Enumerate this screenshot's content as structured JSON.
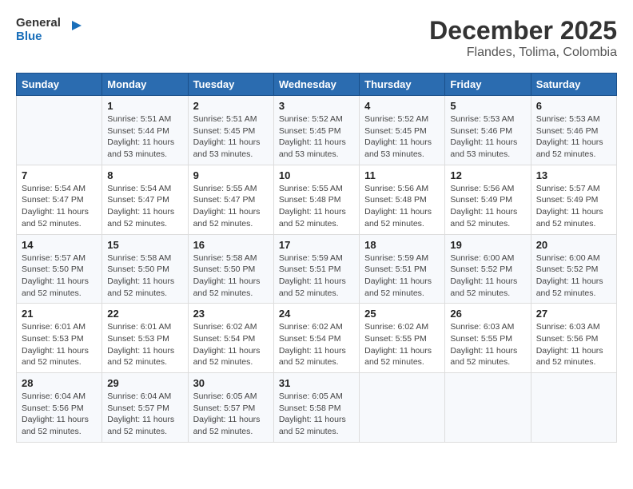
{
  "header": {
    "logo_line1": "General",
    "logo_line2": "Blue",
    "month": "December 2025",
    "location": "Flandes, Tolima, Colombia"
  },
  "days_of_week": [
    "Sunday",
    "Monday",
    "Tuesday",
    "Wednesday",
    "Thursday",
    "Friday",
    "Saturday"
  ],
  "weeks": [
    [
      {
        "day": "",
        "info": ""
      },
      {
        "day": "1",
        "info": "Sunrise: 5:51 AM\nSunset: 5:44 PM\nDaylight: 11 hours\nand 53 minutes."
      },
      {
        "day": "2",
        "info": "Sunrise: 5:51 AM\nSunset: 5:45 PM\nDaylight: 11 hours\nand 53 minutes."
      },
      {
        "day": "3",
        "info": "Sunrise: 5:52 AM\nSunset: 5:45 PM\nDaylight: 11 hours\nand 53 minutes."
      },
      {
        "day": "4",
        "info": "Sunrise: 5:52 AM\nSunset: 5:45 PM\nDaylight: 11 hours\nand 53 minutes."
      },
      {
        "day": "5",
        "info": "Sunrise: 5:53 AM\nSunset: 5:46 PM\nDaylight: 11 hours\nand 53 minutes."
      },
      {
        "day": "6",
        "info": "Sunrise: 5:53 AM\nSunset: 5:46 PM\nDaylight: 11 hours\nand 52 minutes."
      }
    ],
    [
      {
        "day": "7",
        "info": "Sunrise: 5:54 AM\nSunset: 5:47 PM\nDaylight: 11 hours\nand 52 minutes."
      },
      {
        "day": "8",
        "info": "Sunrise: 5:54 AM\nSunset: 5:47 PM\nDaylight: 11 hours\nand 52 minutes."
      },
      {
        "day": "9",
        "info": "Sunrise: 5:55 AM\nSunset: 5:47 PM\nDaylight: 11 hours\nand 52 minutes."
      },
      {
        "day": "10",
        "info": "Sunrise: 5:55 AM\nSunset: 5:48 PM\nDaylight: 11 hours\nand 52 minutes."
      },
      {
        "day": "11",
        "info": "Sunrise: 5:56 AM\nSunset: 5:48 PM\nDaylight: 11 hours\nand 52 minutes."
      },
      {
        "day": "12",
        "info": "Sunrise: 5:56 AM\nSunset: 5:49 PM\nDaylight: 11 hours\nand 52 minutes."
      },
      {
        "day": "13",
        "info": "Sunrise: 5:57 AM\nSunset: 5:49 PM\nDaylight: 11 hours\nand 52 minutes."
      }
    ],
    [
      {
        "day": "14",
        "info": "Sunrise: 5:57 AM\nSunset: 5:50 PM\nDaylight: 11 hours\nand 52 minutes."
      },
      {
        "day": "15",
        "info": "Sunrise: 5:58 AM\nSunset: 5:50 PM\nDaylight: 11 hours\nand 52 minutes."
      },
      {
        "day": "16",
        "info": "Sunrise: 5:58 AM\nSunset: 5:50 PM\nDaylight: 11 hours\nand 52 minutes."
      },
      {
        "day": "17",
        "info": "Sunrise: 5:59 AM\nSunset: 5:51 PM\nDaylight: 11 hours\nand 52 minutes."
      },
      {
        "day": "18",
        "info": "Sunrise: 5:59 AM\nSunset: 5:51 PM\nDaylight: 11 hours\nand 52 minutes."
      },
      {
        "day": "19",
        "info": "Sunrise: 6:00 AM\nSunset: 5:52 PM\nDaylight: 11 hours\nand 52 minutes."
      },
      {
        "day": "20",
        "info": "Sunrise: 6:00 AM\nSunset: 5:52 PM\nDaylight: 11 hours\nand 52 minutes."
      }
    ],
    [
      {
        "day": "21",
        "info": "Sunrise: 6:01 AM\nSunset: 5:53 PM\nDaylight: 11 hours\nand 52 minutes."
      },
      {
        "day": "22",
        "info": "Sunrise: 6:01 AM\nSunset: 5:53 PM\nDaylight: 11 hours\nand 52 minutes."
      },
      {
        "day": "23",
        "info": "Sunrise: 6:02 AM\nSunset: 5:54 PM\nDaylight: 11 hours\nand 52 minutes."
      },
      {
        "day": "24",
        "info": "Sunrise: 6:02 AM\nSunset: 5:54 PM\nDaylight: 11 hours\nand 52 minutes."
      },
      {
        "day": "25",
        "info": "Sunrise: 6:02 AM\nSunset: 5:55 PM\nDaylight: 11 hours\nand 52 minutes."
      },
      {
        "day": "26",
        "info": "Sunrise: 6:03 AM\nSunset: 5:55 PM\nDaylight: 11 hours\nand 52 minutes."
      },
      {
        "day": "27",
        "info": "Sunrise: 6:03 AM\nSunset: 5:56 PM\nDaylight: 11 hours\nand 52 minutes."
      }
    ],
    [
      {
        "day": "28",
        "info": "Sunrise: 6:04 AM\nSunset: 5:56 PM\nDaylight: 11 hours\nand 52 minutes."
      },
      {
        "day": "29",
        "info": "Sunrise: 6:04 AM\nSunset: 5:57 PM\nDaylight: 11 hours\nand 52 minutes."
      },
      {
        "day": "30",
        "info": "Sunrise: 6:05 AM\nSunset: 5:57 PM\nDaylight: 11 hours\nand 52 minutes."
      },
      {
        "day": "31",
        "info": "Sunrise: 6:05 AM\nSunset: 5:58 PM\nDaylight: 11 hours\nand 52 minutes."
      },
      {
        "day": "",
        "info": ""
      },
      {
        "day": "",
        "info": ""
      },
      {
        "day": "",
        "info": ""
      }
    ]
  ]
}
